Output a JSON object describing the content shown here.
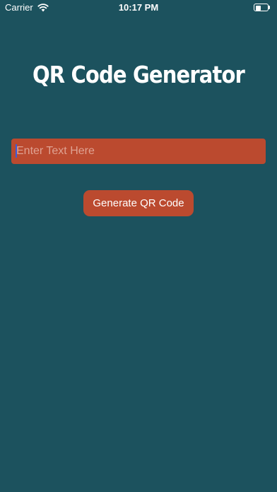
{
  "status_bar": {
    "carrier": "Carrier",
    "time": "10:17 PM",
    "battery_level": 0.45
  },
  "main": {
    "title": "QR Code Generator",
    "input": {
      "placeholder": "Enter Text Here",
      "value": ""
    },
    "generate_button_label": "Generate QR Code"
  },
  "colors": {
    "background": "#1c525e",
    "accent": "#bb4a2f",
    "text": "#ffffff"
  }
}
